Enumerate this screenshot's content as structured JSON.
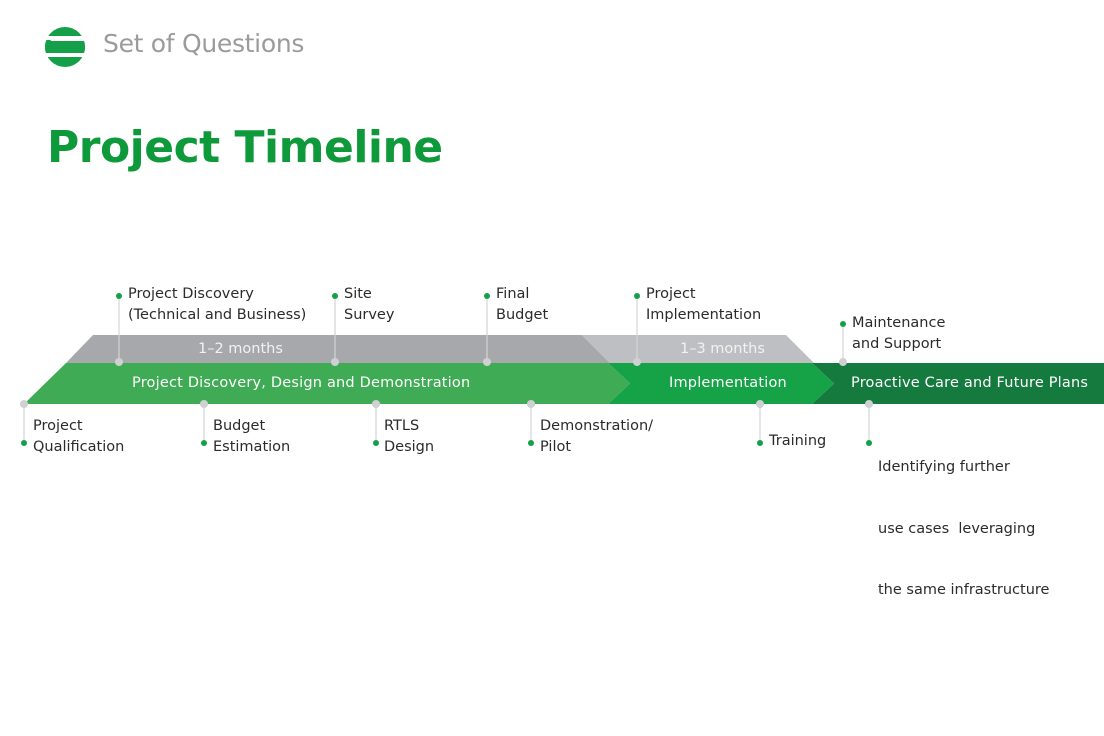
{
  "header": {
    "brand": "Set of Questions",
    "logo_icon": "striped-sphere-logo",
    "title": "Project Timeline"
  },
  "colors": {
    "brand_green": "#0e9a3a",
    "phase1_green": "#3fab54",
    "phase2_green": "#16a247",
    "phase3_green": "#157a3d",
    "duration_gray_dark": "#a7a8ab",
    "duration_gray_light": "#bebfc2",
    "marker_gray": "#cfd0d2",
    "bullet_green": "#14a048"
  },
  "phases": [
    {
      "label": "Project Discovery, Design and Demonstration"
    },
    {
      "label": "Implementation"
    },
    {
      "label": "Proactive Care and Future Plans"
    }
  ],
  "durations": [
    {
      "label": "1–2 months"
    },
    {
      "label": "1–3 months"
    }
  ],
  "milestones_above": [
    {
      "lines": [
        "Project Discovery",
        "(Technical and Business)"
      ]
    },
    {
      "lines": [
        "Site",
        "Survey"
      ]
    },
    {
      "lines": [
        "Final",
        "Budget"
      ]
    },
    {
      "lines": [
        "Project",
        "Implementation"
      ]
    },
    {
      "lines": [
        "Maintenance",
        "and Support"
      ]
    }
  ],
  "milestones_below": [
    {
      "lines": [
        "Project",
        "Qualification"
      ]
    },
    {
      "lines": [
        "Budget",
        "Estimation"
      ]
    },
    {
      "lines": [
        "RTLS",
        "Design"
      ]
    },
    {
      "lines": [
        "Demonstration/",
        "Pilot"
      ]
    },
    {
      "lines": [
        "Training"
      ]
    },
    {
      "lines": [
        "Identifying further",
        "use cases  leveraging",
        "the same infrastructure"
      ]
    }
  ]
}
